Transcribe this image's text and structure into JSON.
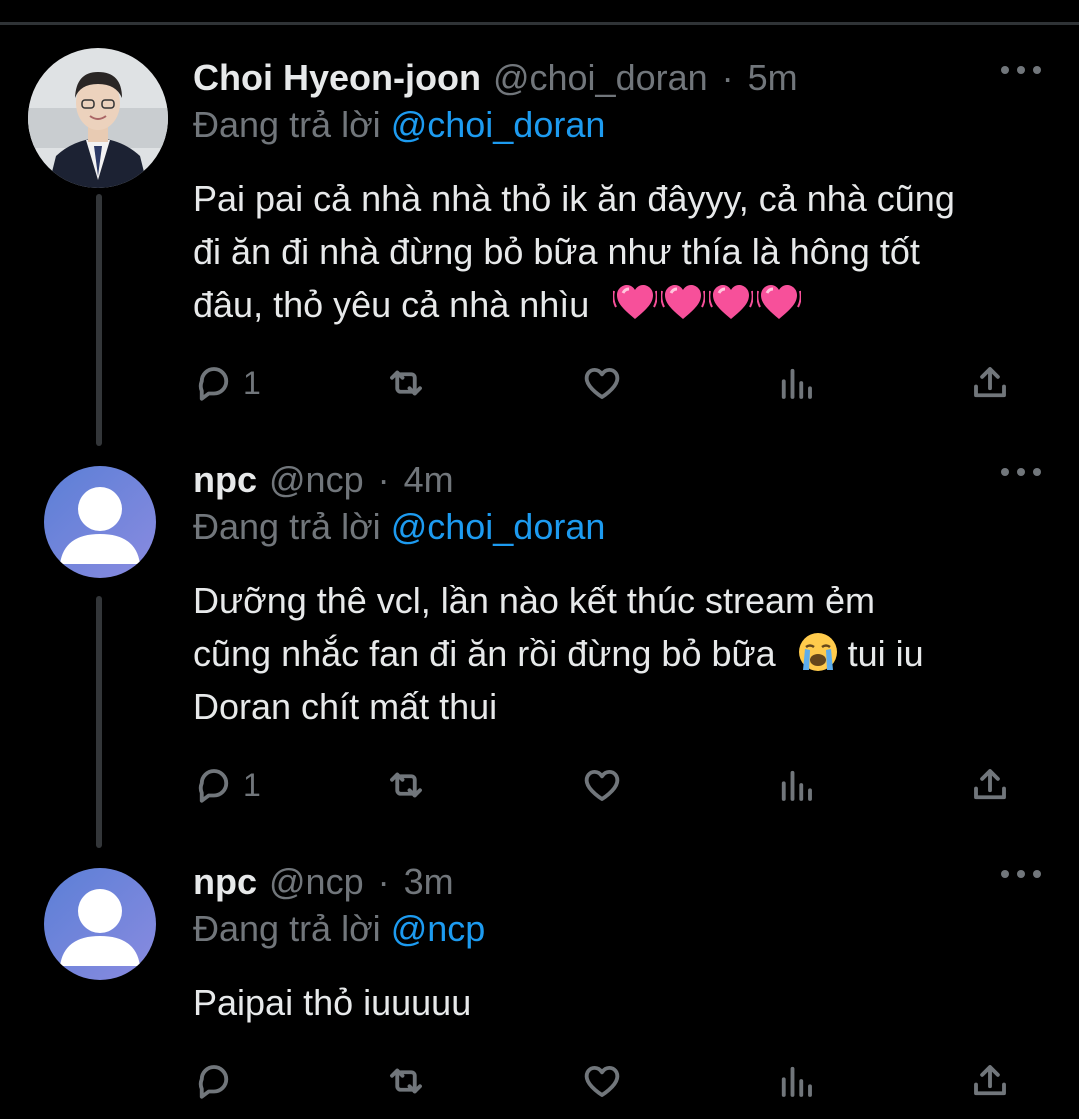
{
  "tweets": [
    {
      "name": "Choi Hyeon-joon",
      "handle": "@choi_doran",
      "dot": "·",
      "time": "5m",
      "replying_prefix": "Đang trả lời ",
      "replying_to": "@choi_doran",
      "lines": [
        "Pai pai cả nhà nhà thỏ ik ăn đâyyy, cả nhà cũng",
        "đi ăn đi nhà đừng bỏ bữa như thía là hông tốt",
        "đâu, thỏ yêu cả nhà nhìu"
      ],
      "emoji": "beating-heart-emoji x4",
      "reply_count": "1"
    },
    {
      "name": "npc",
      "handle": "@ncp",
      "dot": "·",
      "time": "4m",
      "replying_prefix": "Đang trả lời ",
      "replying_to": "@choi_doran",
      "lines": [
        "Dưỡng thê vcl, lần nào kết thúc stream ẻm",
        "cũng nhắc fan đi ăn rồi đừng bỏ bữa",
        "tui iu",
        "Doran chít mất thui"
      ],
      "emoji": "loudly-crying-face-emoji",
      "reply_count": "1"
    },
    {
      "name": "npc",
      "handle": "@ncp",
      "dot": "·",
      "time": "3m",
      "replying_prefix": "Đang trả lời ",
      "replying_to": "@ncp",
      "lines": [
        "Paipai thỏ iuuuuu"
      ],
      "reply_count": ""
    }
  ],
  "colors": {
    "background": "#000000",
    "text": "#e7e9ea",
    "muted": "#71767b",
    "link": "#1d9bf0",
    "heart": "#f7509a"
  },
  "icons": [
    "reply-icon",
    "retweet-icon",
    "like-icon",
    "views-icon",
    "share-icon",
    "more-icon"
  ]
}
